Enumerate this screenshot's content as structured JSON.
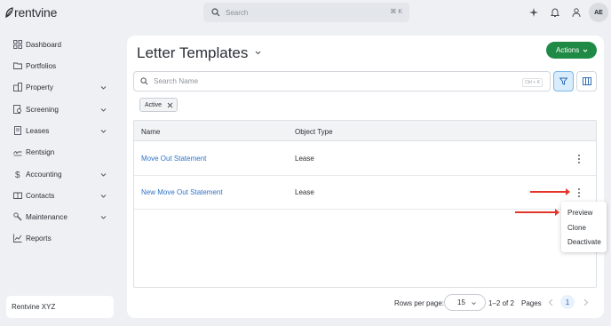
{
  "app": {
    "logo_text": "rentvine",
    "brand_color": "#1f8a45"
  },
  "topbar": {
    "search_placeholder": "Search",
    "search_shortcut": "⌘ K",
    "icons": [
      "sparkle-icon",
      "bell-icon",
      "user-icon"
    ],
    "avatar_initials": "AE"
  },
  "sidebar": {
    "items": [
      {
        "label": "Dashboard",
        "icon": "dashboard-icon",
        "expandable": false
      },
      {
        "label": "Portfolios",
        "icon": "folder-icon",
        "expandable": false
      },
      {
        "label": "Property",
        "icon": "building-icon",
        "expandable": true
      },
      {
        "label": "Screening",
        "icon": "screening-icon",
        "expandable": true
      },
      {
        "label": "Leases",
        "icon": "lease-icon",
        "expandable": true
      },
      {
        "label": "Rentsign",
        "icon": "signature-icon",
        "expandable": false
      },
      {
        "label": "Accounting",
        "icon": "dollar-icon",
        "expandable": true
      },
      {
        "label": "Contacts",
        "icon": "contacts-icon",
        "expandable": true
      },
      {
        "label": "Maintenance",
        "icon": "wrench-icon",
        "expandable": true
      },
      {
        "label": "Reports",
        "icon": "chart-icon",
        "expandable": false
      }
    ],
    "org_name": "Rentvine XYZ"
  },
  "main": {
    "title": "Letter Templates",
    "actions_label": "Actions",
    "search_placeholder": "Search Name",
    "search_shortcut": "Ctrl + K",
    "filter_chip": "Active",
    "table": {
      "headers": {
        "name": "Name",
        "object_type": "Object Type"
      },
      "rows": [
        {
          "name": "Move Out Statement",
          "object_type": "Lease"
        },
        {
          "name": "New Move Out Statement",
          "object_type": "Lease"
        }
      ]
    },
    "pagination": {
      "rows_per_page_label": "Rows per page:",
      "rows_per_page": "15",
      "range": "1–2 of 2",
      "pages_label": "Pages",
      "current_page": "1"
    }
  },
  "context_menu": {
    "items": [
      "Preview",
      "Clone",
      "Deactivate"
    ]
  },
  "annotation_color": "#e2362b"
}
